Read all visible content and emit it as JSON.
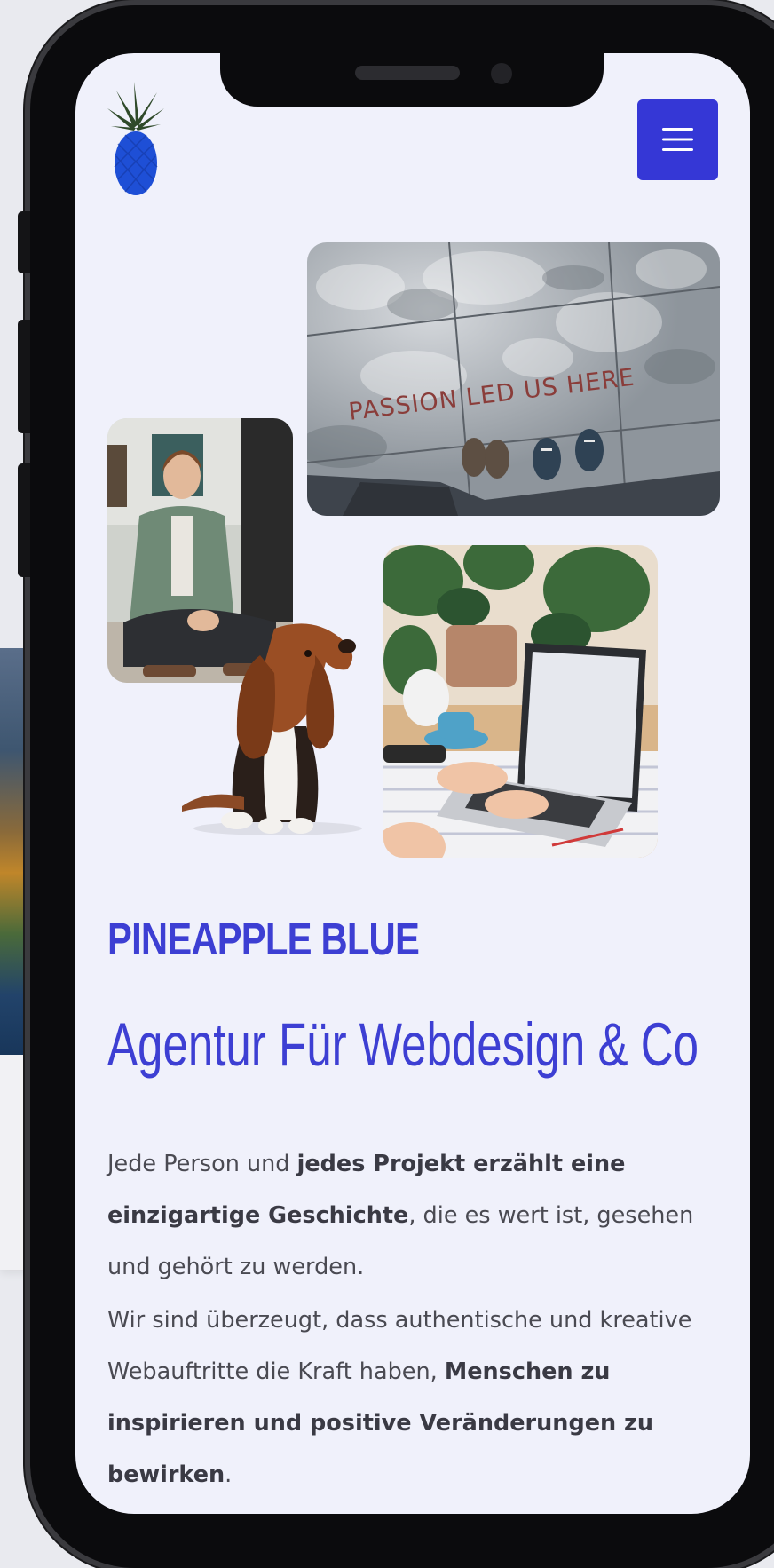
{
  "header": {
    "logo_alt": "Pineapple Blue logo",
    "menu_icon": "hamburger-menu-icon"
  },
  "gallery": {
    "passion_sign_text": "PASSION LED US HERE"
  },
  "hero": {
    "brand": "PINEAPPLE BLUE",
    "headline": "Agentur Für Webdesign & Co"
  },
  "intro": {
    "p1_a": "Jede Person und ",
    "p1_b": "jedes Projekt erzählt eine einzigartige Geschichte",
    "p1_c": ", die es wert ist, gesehen und gehört zu werden.",
    "p2_a": "Wir sind überzeugt, dass authentische und kreative Webauftritte die Kraft haben, ",
    "p2_b": "Menschen zu inspirieren und positive Veränderungen zu bewirken",
    "p2_c": "."
  },
  "colors": {
    "accent": "#3d3fd3",
    "menu_button": "#3537d6",
    "screen_bg": "#f0f1fb",
    "body_text": "#4a4a52"
  }
}
